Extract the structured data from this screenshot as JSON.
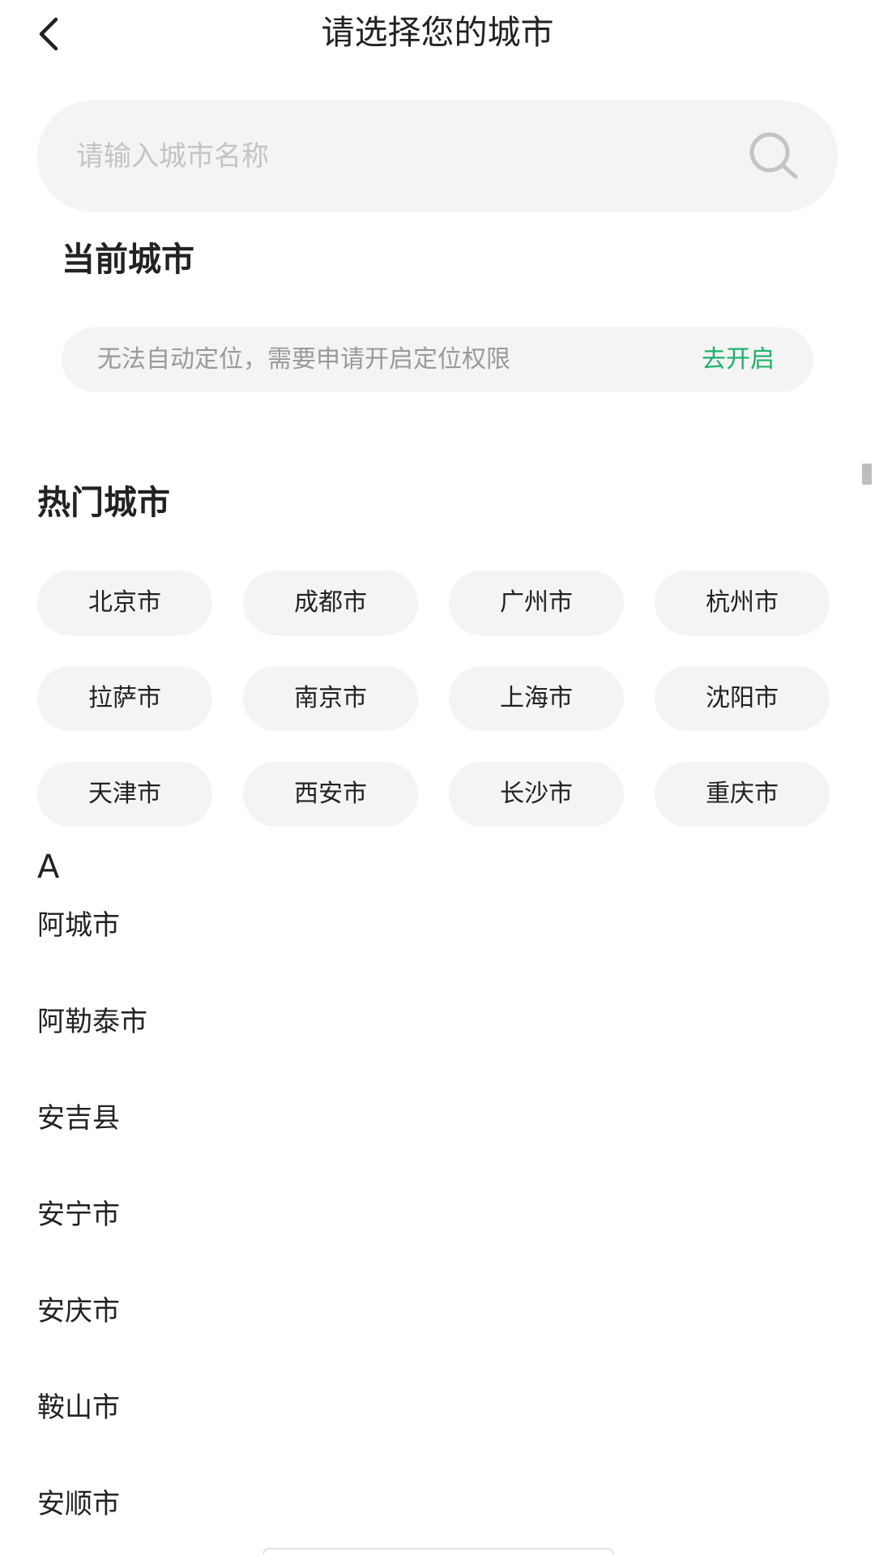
{
  "header": {
    "title": "请选择您的城市"
  },
  "search": {
    "placeholder": "请输入城市名称",
    "value": ""
  },
  "current_city": {
    "title": "当前城市",
    "message": "无法自动定位，需要申请开启定位权限",
    "action_label": "去开启"
  },
  "hot_cities": {
    "title": "热门城市",
    "items": [
      {
        "label": "北京市"
      },
      {
        "label": "成都市"
      },
      {
        "label": "广州市"
      },
      {
        "label": "杭州市"
      },
      {
        "label": "拉萨市"
      },
      {
        "label": "南京市"
      },
      {
        "label": "上海市"
      },
      {
        "label": "沈阳市"
      },
      {
        "label": "天津市"
      },
      {
        "label": "西安市"
      },
      {
        "label": "长沙市"
      },
      {
        "label": "重庆市"
      }
    ]
  },
  "city_index": {
    "letter": "A",
    "cities": [
      {
        "label": "阿城市"
      },
      {
        "label": "阿勒泰市"
      },
      {
        "label": "安吉县"
      },
      {
        "label": "安宁市"
      },
      {
        "label": "安庆市"
      },
      {
        "label": "鞍山市"
      },
      {
        "label": "安顺市"
      }
    ]
  },
  "icons": {
    "back": "chevron-left-icon",
    "search": "search-icon"
  },
  "colors": {
    "accent": "#1bb26a",
    "chip_bg": "#f4f4f4",
    "placeholder": "#c4c4c4",
    "muted_text": "#9a9a9a"
  }
}
